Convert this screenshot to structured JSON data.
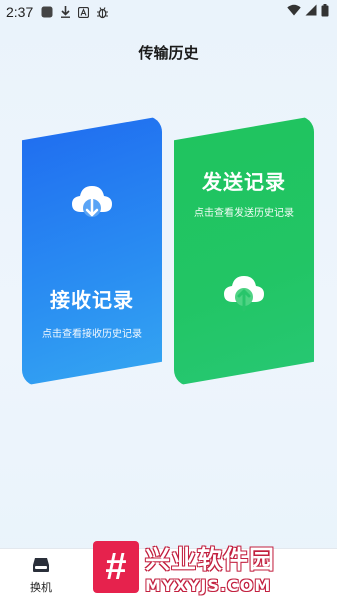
{
  "status_bar": {
    "time": "2:37",
    "icons": [
      "app-icon",
      "download-icon",
      "a-icon",
      "bug-icon",
      "wifi-icon",
      "signal-icon",
      "battery-icon"
    ]
  },
  "header": {
    "title": "传输历史"
  },
  "cards": {
    "receive": {
      "title": "接收记录",
      "subtitle": "点击查看接收历史记录",
      "icon": "cloud-download-icon",
      "color": "#1f6bf0"
    },
    "send": {
      "title": "发送记录",
      "subtitle": "点击查看发送历史记录",
      "icon": "cloud-upload-icon",
      "color": "#22c565"
    }
  },
  "bottom_nav": {
    "items": [
      {
        "label": "换机",
        "icon": "phone-switch-icon"
      }
    ]
  },
  "watermark": {
    "logo": "#",
    "cn": "兴业软件园",
    "en": "MYXYJS.COM",
    "color": "#e6224d"
  }
}
